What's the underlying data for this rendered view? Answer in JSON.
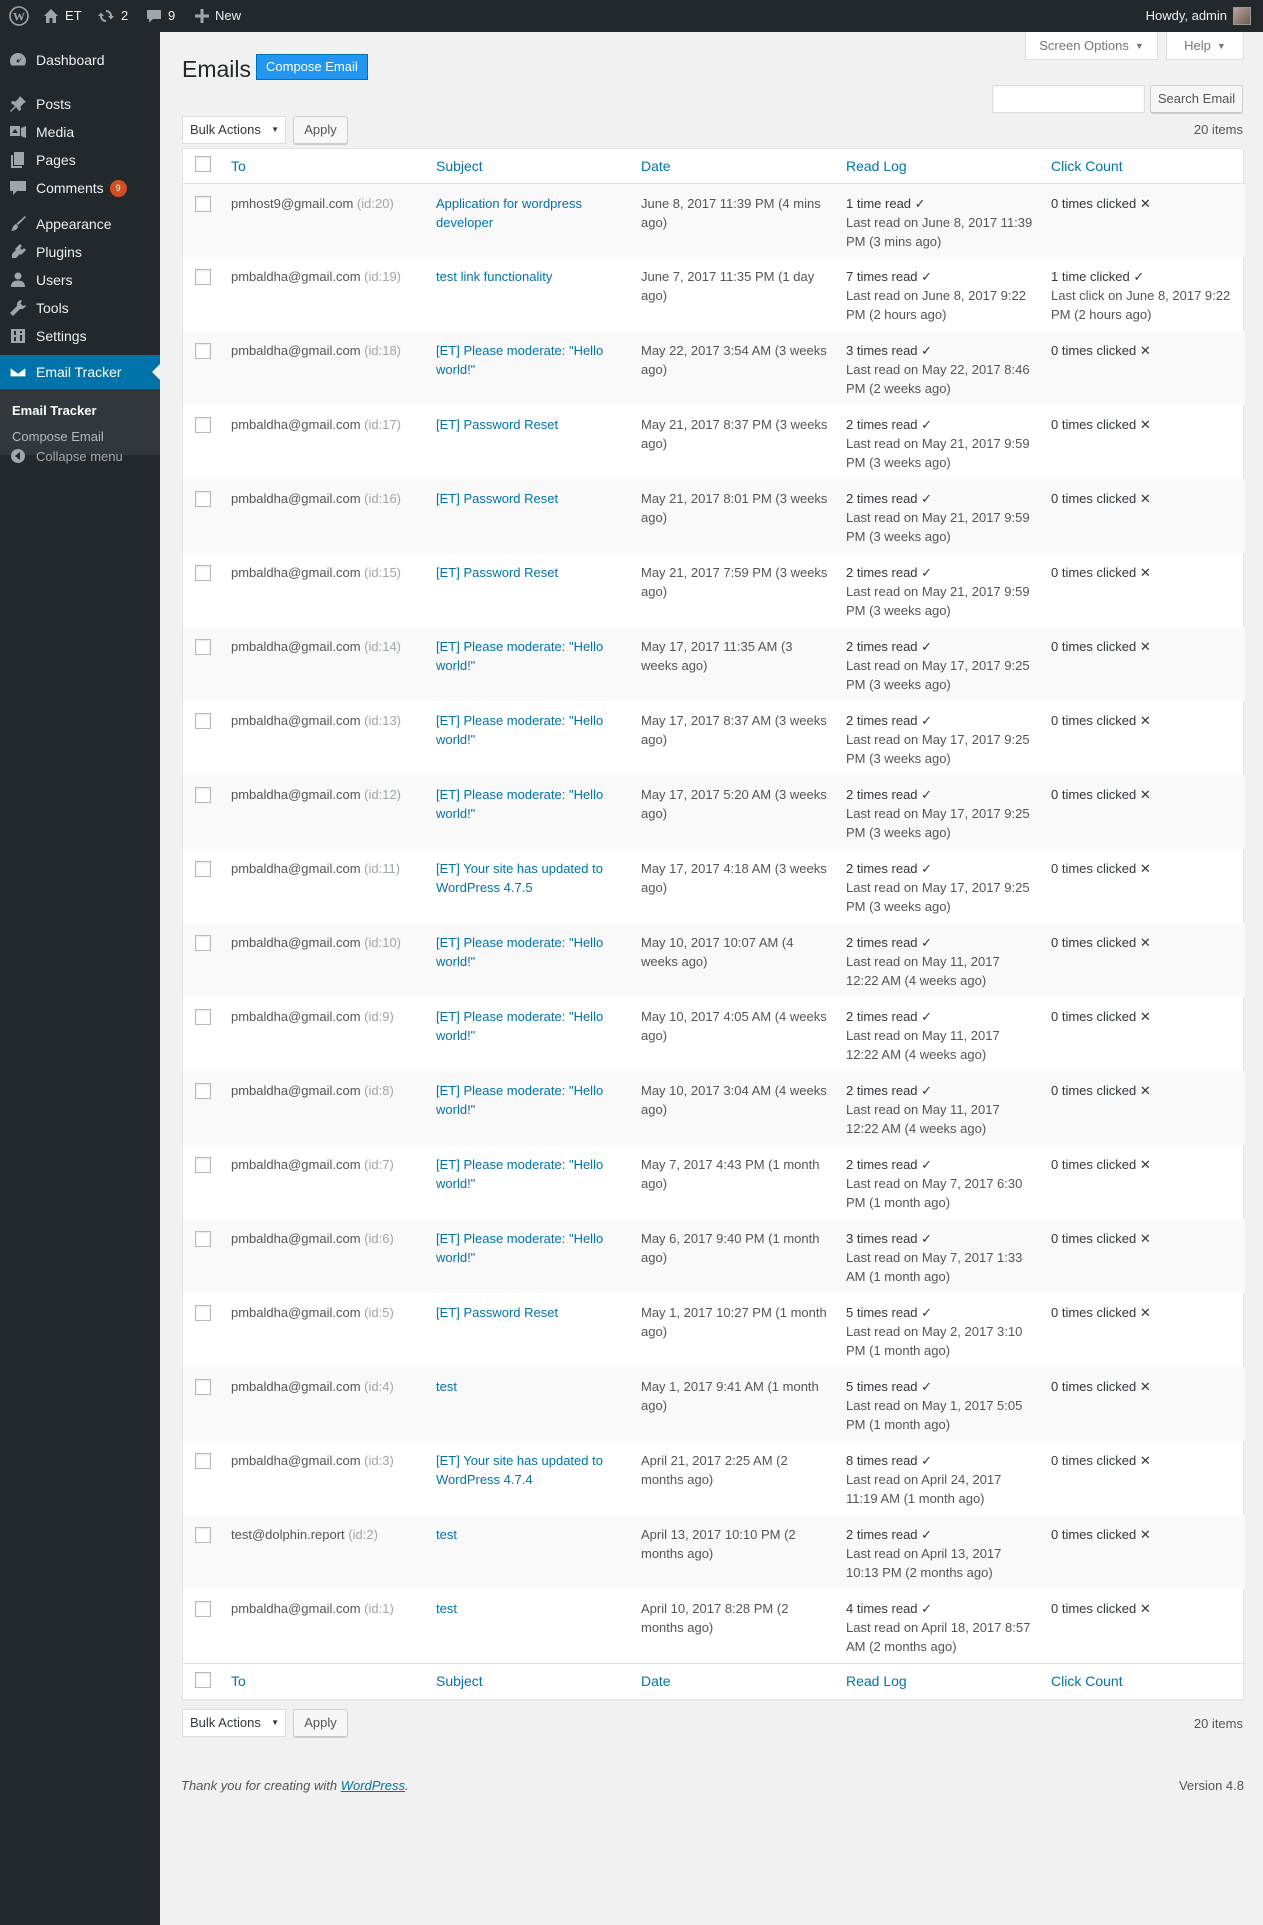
{
  "adminbar": {
    "site_name": "ET",
    "updates_count": "2",
    "comments_count": "9",
    "new_label": "New",
    "howdy": "Howdy, admin"
  },
  "sidebar": {
    "items": [
      {
        "label": "Dashboard",
        "icon": "dashboard-icon"
      },
      {
        "label": "Posts",
        "icon": "pin-icon"
      },
      {
        "label": "Media",
        "icon": "media-icon"
      },
      {
        "label": "Pages",
        "icon": "pages-icon"
      },
      {
        "label": "Comments",
        "icon": "comments-icon",
        "badge": "9"
      },
      {
        "label": "Appearance",
        "icon": "brush-icon"
      },
      {
        "label": "Plugins",
        "icon": "plug-icon"
      },
      {
        "label": "Users",
        "icon": "users-icon"
      },
      {
        "label": "Tools",
        "icon": "wrench-icon"
      },
      {
        "label": "Settings",
        "icon": "settings-icon"
      },
      {
        "label": "Email Tracker",
        "icon": "mail-icon",
        "current": true
      }
    ],
    "submenu": [
      "Email Tracker",
      "Compose Email"
    ],
    "collapse": "Collapse menu"
  },
  "screen_options": "Screen Options",
  "help": "Help",
  "header": {
    "title": "Emails",
    "compose_button": "Compose Email"
  },
  "search": {
    "value": "",
    "button": "Search Email"
  },
  "bulk": {
    "selected": "Bulk Actions",
    "apply": "Apply"
  },
  "items_count": "20 items",
  "columns": [
    "To",
    "Subject",
    "Date",
    "Read Log",
    "Click Count"
  ],
  "rows": [
    {
      "to": "pmhost9@gmail.com",
      "id": "(id:20)",
      "subject": "Application for wordpress developer",
      "date": "June 8, 2017 11:39 PM (4 mins ago)",
      "read": "1 time read",
      "read_detail": "Last read on June 8, 2017 11:39 PM  (3 mins ago)",
      "click": "0 times clicked",
      "click_detail": "",
      "clicked": false
    },
    {
      "to": "pmbaldha@gmail.com",
      "id": "(id:19)",
      "subject": "test link functionality",
      "date": "June 7, 2017 11:35 PM (1 day ago)",
      "read": "7 times read",
      "read_detail": "Last read on June 8, 2017 9:22 PM  (2 hours ago)",
      "click": "1 time clicked",
      "click_detail": "Last click on June 8, 2017 9:22 PM  (2 hours ago)",
      "clicked": true
    },
    {
      "to": "pmbaldha@gmail.com",
      "id": "(id:18)",
      "subject": "[ET] Please moderate: \"Hello world!\"",
      "date": "May 22, 2017 3:54 AM (3 weeks ago)",
      "read": "3 times read",
      "read_detail": "Last read on May 22, 2017 8:46 PM  (2 weeks ago)",
      "click": "0 times clicked",
      "click_detail": "",
      "clicked": false
    },
    {
      "to": "pmbaldha@gmail.com",
      "id": "(id:17)",
      "subject": "[ET] Password Reset",
      "date": "May 21, 2017 8:37 PM (3 weeks ago)",
      "read": "2 times read",
      "read_detail": "Last read on May 21, 2017 9:59 PM  (3 weeks ago)",
      "click": "0 times clicked",
      "click_detail": "",
      "clicked": false
    },
    {
      "to": "pmbaldha@gmail.com",
      "id": "(id:16)",
      "subject": "[ET] Password Reset",
      "date": "May 21, 2017 8:01 PM (3 weeks ago)",
      "read": "2 times read",
      "read_detail": "Last read on May 21, 2017 9:59 PM  (3 weeks ago)",
      "click": "0 times clicked",
      "click_detail": "",
      "clicked": false
    },
    {
      "to": "pmbaldha@gmail.com",
      "id": "(id:15)",
      "subject": "[ET] Password Reset",
      "date": "May 21, 2017 7:59 PM (3 weeks ago)",
      "read": "2 times read",
      "read_detail": "Last read on May 21, 2017 9:59 PM  (3 weeks ago)",
      "click": "0 times clicked",
      "click_detail": "",
      "clicked": false
    },
    {
      "to": "pmbaldha@gmail.com",
      "id": "(id:14)",
      "subject": "[ET] Please moderate: \"Hello world!\"",
      "date": "May 17, 2017 11:35 AM (3 weeks ago)",
      "read": "2 times read",
      "read_detail": "Last read on May 17, 2017 9:25 PM  (3 weeks ago)",
      "click": "0 times clicked",
      "click_detail": "",
      "clicked": false
    },
    {
      "to": "pmbaldha@gmail.com",
      "id": "(id:13)",
      "subject": "[ET] Please moderate: \"Hello world!\"",
      "date": "May 17, 2017 8:37 AM (3 weeks ago)",
      "read": "2 times read",
      "read_detail": "Last read on May 17, 2017 9:25 PM  (3 weeks ago)",
      "click": "0 times clicked",
      "click_detail": "",
      "clicked": false
    },
    {
      "to": "pmbaldha@gmail.com",
      "id": "(id:12)",
      "subject": "[ET] Please moderate: \"Hello world!\"",
      "date": "May 17, 2017 5:20 AM (3 weeks ago)",
      "read": "2 times read",
      "read_detail": "Last read on May 17, 2017 9:25 PM  (3 weeks ago)",
      "click": "0 times clicked",
      "click_detail": "",
      "clicked": false
    },
    {
      "to": "pmbaldha@gmail.com",
      "id": "(id:11)",
      "subject": "[ET] Your site has updated to WordPress 4.7.5",
      "date": "May 17, 2017 4:18 AM (3 weeks ago)",
      "read": "2 times read",
      "read_detail": "Last read on May 17, 2017 9:25 PM  (3 weeks ago)",
      "click": "0 times clicked",
      "click_detail": "",
      "clicked": false
    },
    {
      "to": "pmbaldha@gmail.com",
      "id": "(id:10)",
      "subject": "[ET] Please moderate: \"Hello world!\"",
      "date": "May 10, 2017 10:07 AM (4 weeks ago)",
      "read": "2 times read",
      "read_detail": "Last read on May 11, 2017 12:22 AM  (4 weeks ago)",
      "click": "0 times clicked",
      "click_detail": "",
      "clicked": false
    },
    {
      "to": "pmbaldha@gmail.com",
      "id": "(id:9)",
      "subject": "[ET] Please moderate: \"Hello world!\"",
      "date": "May 10, 2017 4:05 AM (4 weeks ago)",
      "read": "2 times read",
      "read_detail": "Last read on May 11, 2017 12:22 AM  (4 weeks ago)",
      "click": "0 times clicked",
      "click_detail": "",
      "clicked": false
    },
    {
      "to": "pmbaldha@gmail.com",
      "id": "(id:8)",
      "subject": "[ET] Please moderate: \"Hello world!\"",
      "date": "May 10, 2017 3:04 AM (4 weeks ago)",
      "read": "2 times read",
      "read_detail": "Last read on May 11, 2017 12:22 AM  (4 weeks ago)",
      "click": "0 times clicked",
      "click_detail": "",
      "clicked": false
    },
    {
      "to": "pmbaldha@gmail.com",
      "id": "(id:7)",
      "subject": "[ET] Please moderate: \"Hello world!\"",
      "date": "May 7, 2017 4:43 PM (1 month ago)",
      "read": "2 times read",
      "read_detail": "Last read on May 7, 2017 6:30 PM  (1 month ago)",
      "click": "0 times clicked",
      "click_detail": "",
      "clicked": false
    },
    {
      "to": "pmbaldha@gmail.com",
      "id": "(id:6)",
      "subject": "[ET] Please moderate: \"Hello world!\"",
      "date": "May 6, 2017 9:40 PM (1 month ago)",
      "read": "3 times read",
      "read_detail": "Last read on May 7, 2017 1:33 AM  (1 month ago)",
      "click": "0 times clicked",
      "click_detail": "",
      "clicked": false
    },
    {
      "to": "pmbaldha@gmail.com",
      "id": "(id:5)",
      "subject": "[ET] Password Reset",
      "date": "May 1, 2017 10:27 PM (1 month ago)",
      "read": "5 times read",
      "read_detail": "Last read on May 2, 2017 3:10 PM  (1 month ago)",
      "click": "0 times clicked",
      "click_detail": "",
      "clicked": false
    },
    {
      "to": "pmbaldha@gmail.com",
      "id": "(id:4)",
      "subject": "test",
      "date": "May 1, 2017 9:41 AM (1 month ago)",
      "read": "5 times read",
      "read_detail": "Last read on May 1, 2017 5:05 PM  (1 month ago)",
      "click": "0 times clicked",
      "click_detail": "",
      "clicked": false
    },
    {
      "to": "pmbaldha@gmail.com",
      "id": "(id:3)",
      "subject": "[ET] Your site has updated to WordPress 4.7.4",
      "date": "April 21, 2017 2:25 AM (2 months ago)",
      "read": "8 times read",
      "read_detail": "Last read on April 24, 2017 11:19 AM  (1 month ago)",
      "click": "0 times clicked",
      "click_detail": "",
      "clicked": false
    },
    {
      "to": "test@dolphin.report",
      "id": "(id:2)",
      "subject": "test",
      "date": "April 13, 2017 10:10 PM (2 months ago)",
      "read": "2 times read",
      "read_detail": "Last read on April 13, 2017 10:13 PM  (2 months ago)",
      "click": "0 times clicked",
      "click_detail": "",
      "clicked": false
    },
    {
      "to": "pmbaldha@gmail.com",
      "id": "(id:1)",
      "subject": "test",
      "date": "April 10, 2017 8:28 PM (2 months ago)",
      "read": "4 times read",
      "read_detail": "Last read on April 18, 2017 8:57 AM  (2 months ago)",
      "click": "0 times clicked",
      "click_detail": "",
      "clicked": false
    }
  ],
  "footer": {
    "thanks_prefix": "Thank you for creating with ",
    "thanks_link": "WordPress",
    "thanks_suffix": ".",
    "version": "Version 4.8"
  },
  "colors": {
    "sidebar_bg": "#23282d",
    "accent": "#0073aa",
    "compose_button": "#2196f3"
  }
}
